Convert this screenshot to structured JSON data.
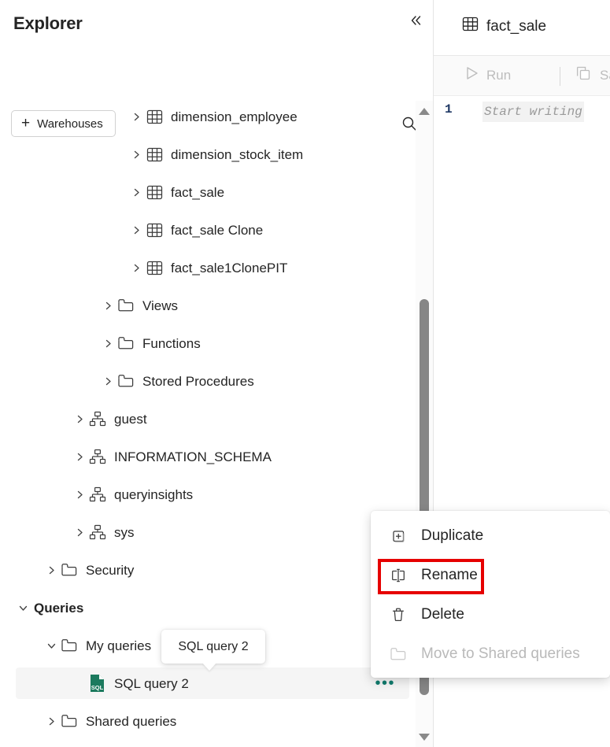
{
  "explorer": {
    "title": "Explorer",
    "collapse_icon": "double-chevron-left-icon",
    "search_icon": "search-icon",
    "add_button": {
      "label": "Warehouses",
      "icon": "plus-icon"
    },
    "tree": [
      {
        "label": "dimension_employee",
        "icon": "table-icon",
        "indent": 183,
        "chevron": "right",
        "level": 3
      },
      {
        "label": "dimension_stock_item",
        "icon": "table-icon",
        "indent": 183,
        "chevron": "right",
        "level": 3
      },
      {
        "label": "fact_sale",
        "icon": "table-icon",
        "indent": 183,
        "chevron": "right",
        "level": 3
      },
      {
        "label": "fact_sale Clone",
        "icon": "table-icon",
        "indent": 183,
        "chevron": "right",
        "level": 3
      },
      {
        "label": "fact_sale1ClonePIT",
        "icon": "table-icon",
        "indent": 183,
        "chevron": "right",
        "level": 3
      },
      {
        "label": "Views",
        "icon": "folder-icon",
        "indent": 147,
        "chevron": "right",
        "level": 2
      },
      {
        "label": "Functions",
        "icon": "folder-icon",
        "indent": 147,
        "chevron": "right",
        "level": 2
      },
      {
        "label": "Stored Procedures",
        "icon": "folder-icon",
        "indent": 147,
        "chevron": "right",
        "level": 2
      },
      {
        "label": "guest",
        "icon": "schema-icon",
        "indent": 111,
        "chevron": "right",
        "level": 1
      },
      {
        "label": "INFORMATION_SCHEMA",
        "icon": "schema-icon",
        "indent": 111,
        "chevron": "right",
        "level": 1
      },
      {
        "label": "queryinsights",
        "icon": "schema-icon",
        "indent": 111,
        "chevron": "right",
        "level": 1
      },
      {
        "label": "sys",
        "icon": "schema-icon",
        "indent": 111,
        "chevron": "right",
        "level": 1
      },
      {
        "label": "Security",
        "icon": "folder-icon",
        "indent": 75,
        "chevron": "right",
        "level": 0
      },
      {
        "label": "Queries",
        "icon": "none",
        "indent": 39,
        "chevron": "down",
        "level": 0,
        "bold": true
      },
      {
        "label": "My queries",
        "icon": "folder-icon",
        "indent": 75,
        "chevron": "down",
        "level": 1
      },
      {
        "label": "SQL query 2",
        "icon": "sql-file-icon",
        "indent": 111,
        "chevron": "none",
        "level": 2,
        "selected": true,
        "overflow": "•••"
      },
      {
        "label": "Shared queries",
        "icon": "folder-icon",
        "indent": 75,
        "chevron": "right",
        "level": 1
      }
    ],
    "scrollbar": {
      "up_icon": "scroll-up-arrow-icon",
      "down_icon": "scroll-down-arrow-icon"
    }
  },
  "tooltip": {
    "text": "SQL query 2"
  },
  "context_menu": {
    "items": [
      {
        "label": "Duplicate",
        "icon": "duplicate-icon",
        "disabled": false
      },
      {
        "label": "Rename",
        "icon": "rename-icon",
        "disabled": false,
        "highlighted": true
      },
      {
        "label": "Delete",
        "icon": "trash-icon",
        "disabled": false
      },
      {
        "label": "Move to Shared queries",
        "icon": "folder-icon",
        "disabled": true
      }
    ],
    "highlight_color": "#e60000"
  },
  "editor": {
    "tab": {
      "label": "fact_sale",
      "icon": "table-icon"
    },
    "toolbar": {
      "run_label": "Run",
      "run_icon": "play-icon",
      "save_label": "Save",
      "save_icon": "save-as-icon"
    },
    "code": {
      "line_number": "1",
      "placeholder": "Start writing"
    }
  }
}
